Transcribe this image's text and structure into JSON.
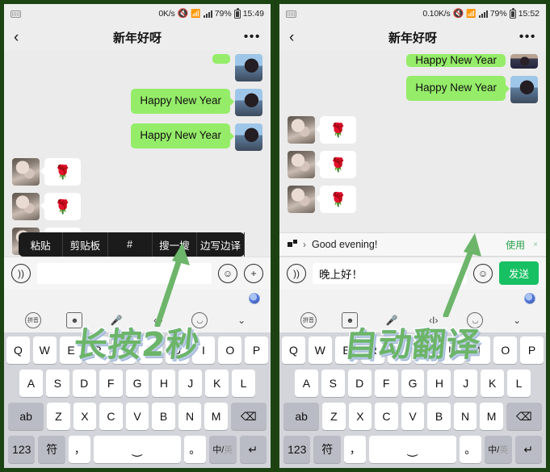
{
  "panels": [
    {
      "id": "left",
      "status": {
        "sim_icon": "sim-card-icon",
        "speed": "0K/s",
        "mute_icon": "mute-icon",
        "wifi_icon": "wifi-icon",
        "signal_icon": "signal-bars-icon",
        "battery_pct": "79%",
        "battery_icon": "battery-icon",
        "time": "15:49"
      },
      "nav": {
        "back_icon": "chevron-left-icon",
        "title": "新年好呀",
        "more_icon": "more-options-icon"
      },
      "messages": [
        {
          "side": "out",
          "type": "clipped",
          "text": "",
          "avatar": "av-me"
        },
        {
          "side": "out",
          "type": "text",
          "text": "Happy New Year",
          "avatar": "av-me"
        },
        {
          "side": "out",
          "type": "text",
          "text": "Happy New Year",
          "avatar": "av-me"
        },
        {
          "side": "in",
          "type": "sticker",
          "text": "🌹",
          "avatar": "av-them"
        },
        {
          "side": "in",
          "type": "sticker",
          "text": "🌹",
          "avatar": "av-them"
        },
        {
          "side": "in",
          "type": "sticker",
          "text": "🌹",
          "avatar": "av-them"
        }
      ],
      "clipboard_toolbar": [
        "粘贴",
        "剪贴板",
        "#",
        "搜一搜",
        "边写边译"
      ],
      "input": {
        "voice_icon": "voice-input-icon",
        "value": "",
        "placeholder": "",
        "emoji_icon": "emoji-icon",
        "plus_icon": "plus-icon"
      },
      "overlay_text": "长按2秒"
    },
    {
      "id": "right",
      "status": {
        "sim_icon": "sim-card-icon",
        "speed": "0.10K/s",
        "mute_icon": "mute-icon",
        "wifi_icon": "wifi-icon",
        "signal_icon": "signal-bars-icon",
        "battery_pct": "79%",
        "battery_icon": "battery-icon",
        "time": "15:52"
      },
      "nav": {
        "back_icon": "chevron-left-icon",
        "title": "新年好呀",
        "more_icon": "more-options-icon"
      },
      "messages": [
        {
          "side": "out",
          "type": "clipped",
          "text": "Happy New Year",
          "avatar": "av-me2"
        },
        {
          "side": "out",
          "type": "text",
          "text": "Happy New Year",
          "avatar": "av-me"
        },
        {
          "side": "in",
          "type": "sticker",
          "text": "🌹",
          "avatar": "av-them"
        },
        {
          "side": "in",
          "type": "sticker",
          "text": "🌹",
          "avatar": "av-them"
        },
        {
          "side": "in",
          "type": "sticker",
          "text": "🌹",
          "avatar": "av-them"
        }
      ],
      "translate_bar": {
        "icon": "translate-icon",
        "chevron": "›",
        "text": "Good evening!",
        "use_label": "使用",
        "close_icon": "×"
      },
      "input": {
        "voice_icon": "voice-input-icon",
        "value": "晚上好！",
        "placeholder": "",
        "emoji_icon": "emoji-icon",
        "send_label": "发送"
      },
      "overlay_text": "自动翻译"
    }
  ],
  "keyboard": {
    "tools": [
      "pinyin-mode-icon",
      "sticker-icon",
      "microphone-icon",
      "cursor-move-icon",
      "emoticon-icon",
      "collapse-keyboard-icon"
    ],
    "row1": [
      "Q",
      "W",
      "E",
      "R",
      "T",
      "Y",
      "U",
      "I",
      "O",
      "P"
    ],
    "row2": [
      "A",
      "S",
      "D",
      "F",
      "G",
      "H",
      "J",
      "K",
      "L"
    ],
    "row3": [
      "ab",
      "Z",
      "X",
      "C",
      "V",
      "B",
      "N",
      "M",
      "⌫"
    ],
    "row4_num": "123",
    "row4_symbol": "符",
    "row4_comma": "，",
    "row4_space_icon": "space-key-icon",
    "row4_period": "。",
    "row4_lang_cn": "中",
    "row4_lang_en": "英",
    "row4_enter": "↵"
  },
  "colors": {
    "bubble_green": "#95ec69",
    "send_green": "#17c063",
    "use_green": "#2ba24c",
    "frame_green": "#1c4412",
    "chat_bg": "#ebebeb",
    "keyboard_bg": "#d3d5da",
    "overlay_text_green": "#6cb568"
  }
}
